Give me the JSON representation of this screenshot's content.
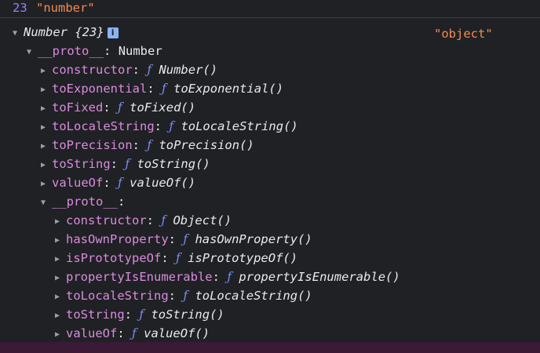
{
  "header": {
    "value": "23",
    "string": "\"number\""
  },
  "root": {
    "label": "Number",
    "preview": "{23}",
    "info": "i",
    "type": "\"object\""
  },
  "proto1": {
    "key": "__proto__",
    "value": "Number"
  },
  "number_props": [
    {
      "key": "constructor",
      "fn": "Number()"
    },
    {
      "key": "toExponential",
      "fn": "toExponential()"
    },
    {
      "key": "toFixed",
      "fn": "toFixed()"
    },
    {
      "key": "toLocaleString",
      "fn": "toLocaleString()"
    },
    {
      "key": "toPrecision",
      "fn": "toPrecision()"
    },
    {
      "key": "toString",
      "fn": "toString()"
    },
    {
      "key": "valueOf",
      "fn": "valueOf()"
    }
  ],
  "proto2": {
    "key": "__proto__",
    "value": ""
  },
  "object_props": [
    {
      "key": "constructor",
      "fn": "Object()"
    },
    {
      "key": "hasOwnProperty",
      "fn": "hasOwnProperty()"
    },
    {
      "key": "isPrototypeOf",
      "fn": "isPrototypeOf()"
    },
    {
      "key": "propertyIsEnumerable",
      "fn": "propertyIsEnumerable()"
    },
    {
      "key": "toLocaleString",
      "fn": "toLocaleString()"
    },
    {
      "key": "toString",
      "fn": "toString()"
    },
    {
      "key": "valueOf",
      "fn": "valueOf()"
    }
  ],
  "glyphs": {
    "expanded": "▼",
    "collapsed": "▶",
    "function": "ƒ",
    "colon": ":"
  }
}
